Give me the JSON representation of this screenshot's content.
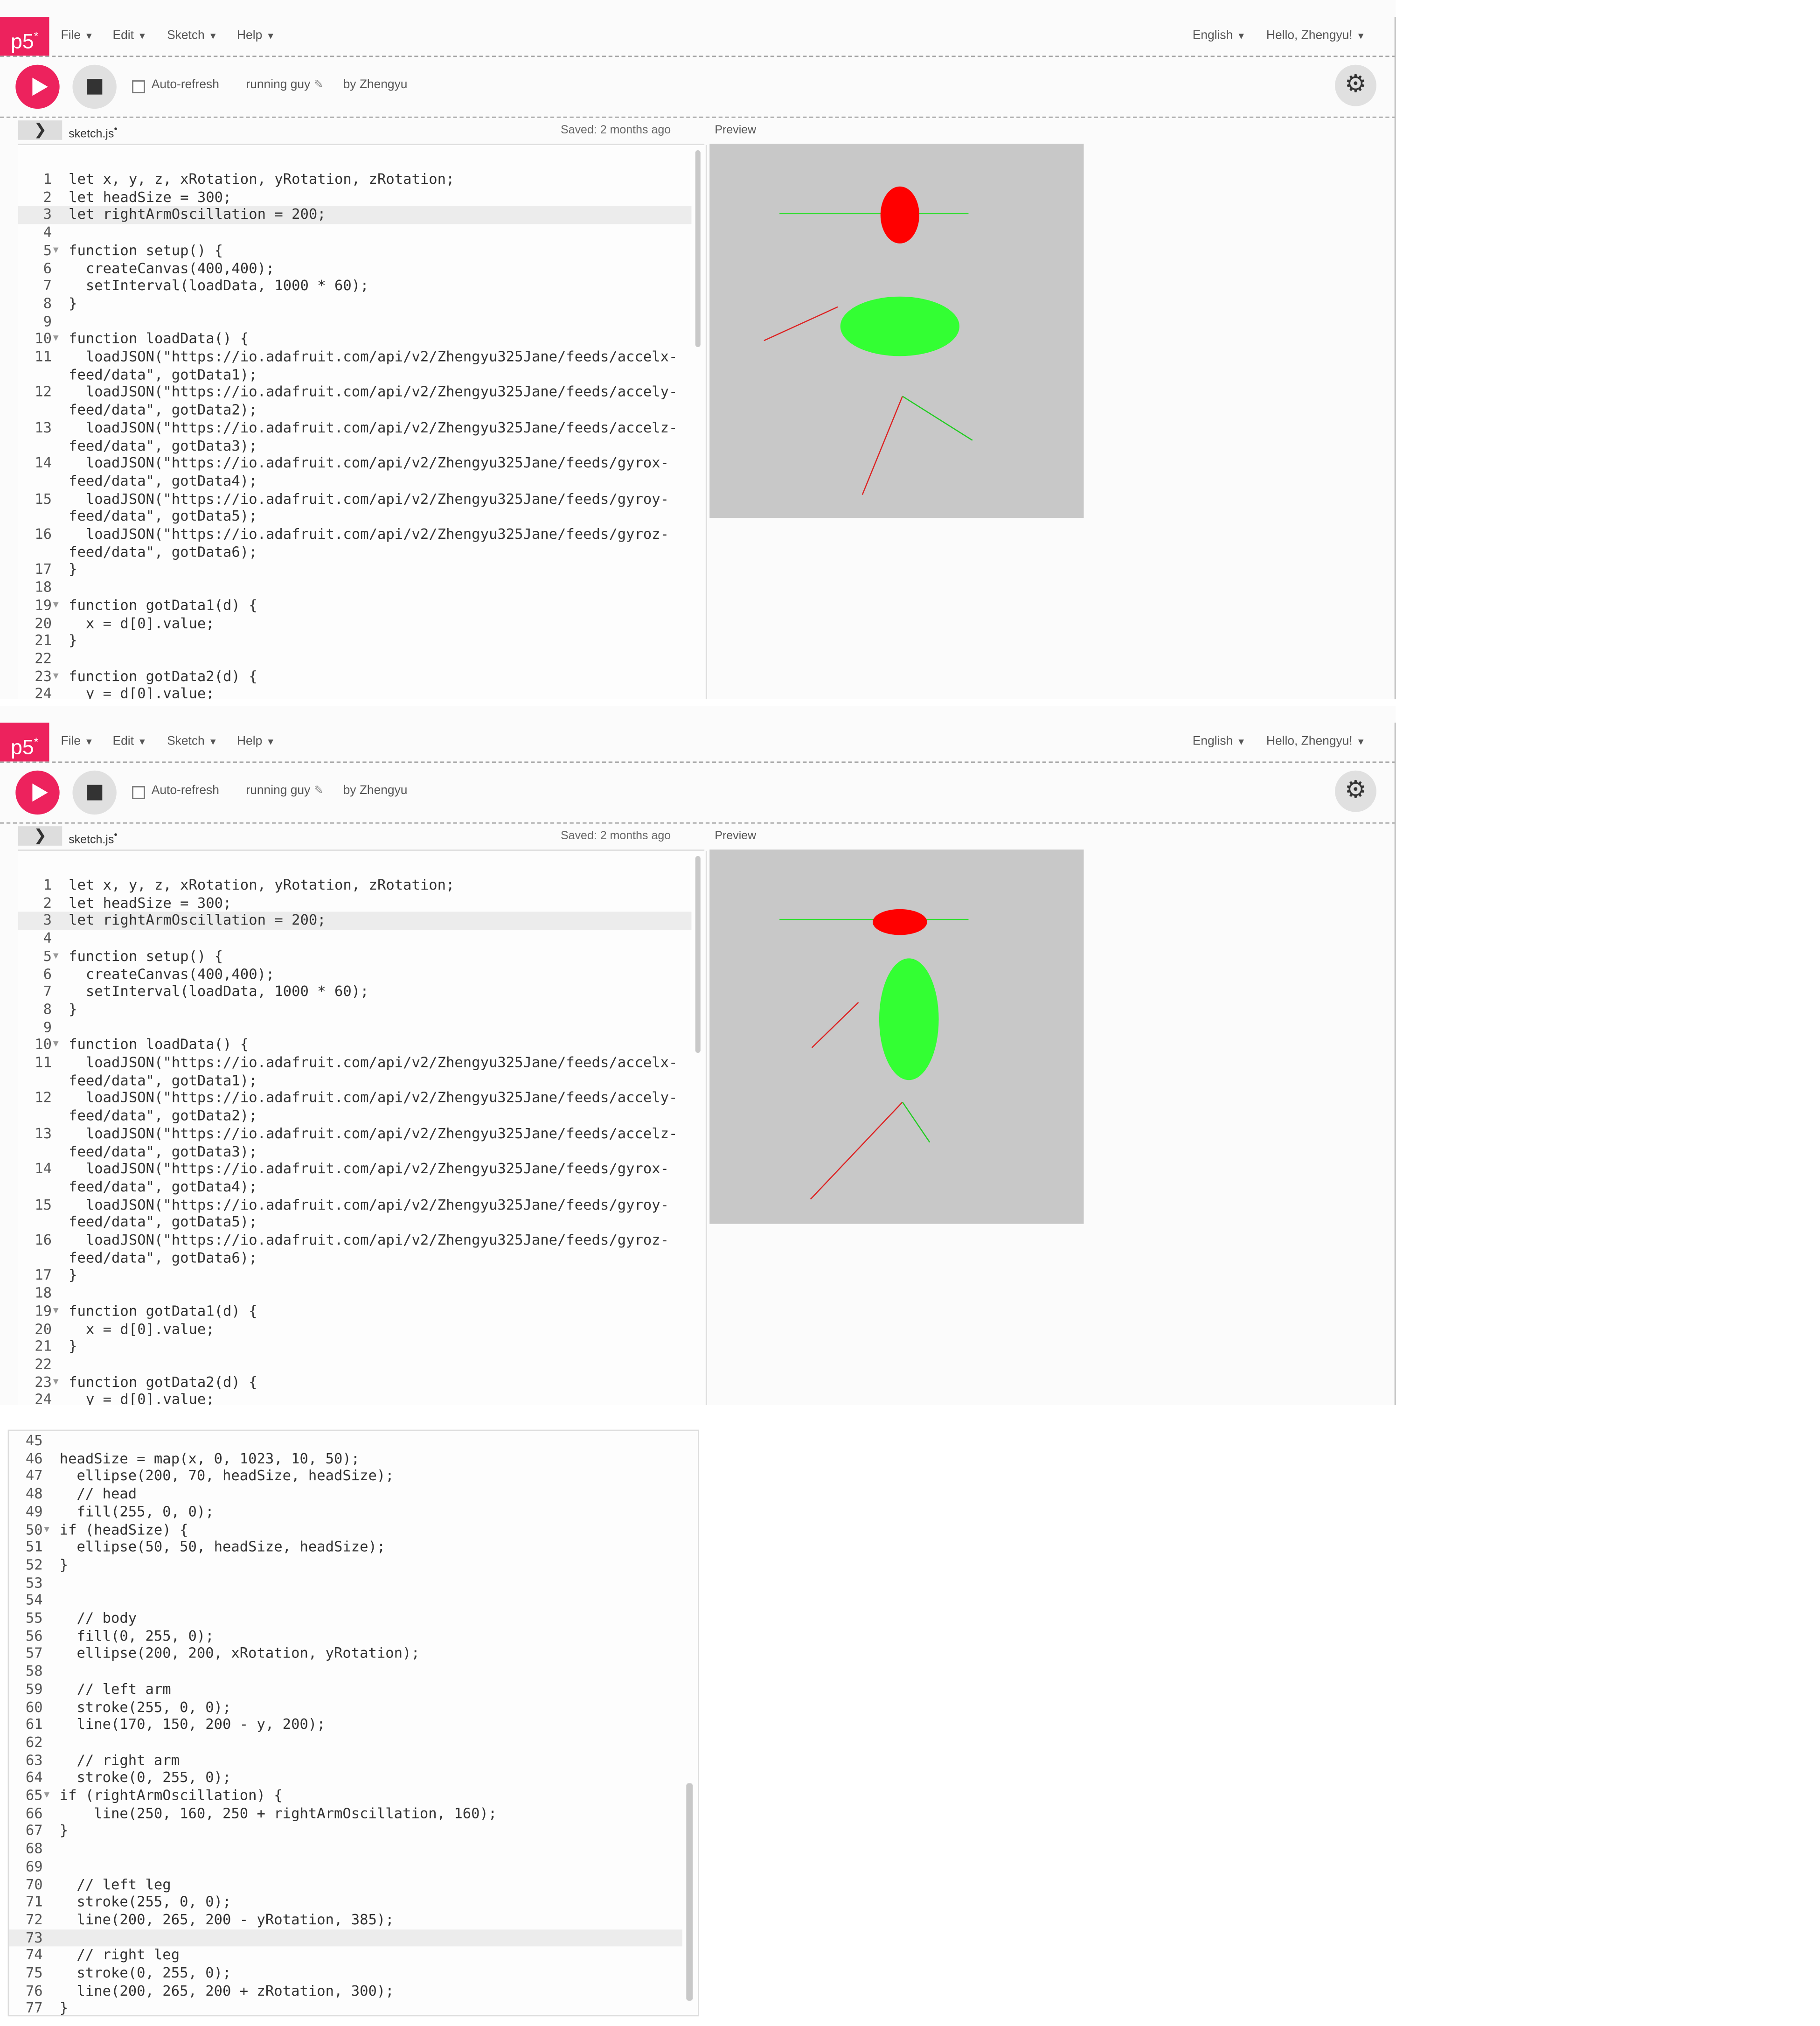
{
  "app": {
    "logo": "p5*",
    "menus": [
      "File",
      "Edit",
      "Sketch",
      "Help"
    ],
    "language": "English",
    "user": "Hello, Zhengyu!"
  },
  "toolbar": {
    "auto_refresh_label": "Auto-refresh",
    "sketch_name": "running guy",
    "author": "by Zhengyu"
  },
  "editor": {
    "file_name": "sketch.js",
    "saved_status": "Saved: 2 months ago",
    "preview_label": "Preview"
  },
  "code_top": [
    {
      "n": "1",
      "t": "let x, y, z, xRotation, yRotation, zRotation;"
    },
    {
      "n": "2",
      "t": "let headSize = 300;"
    },
    {
      "n": "3",
      "t": "let rightArmOscillation = 200;"
    },
    {
      "n": "4",
      "t": ""
    },
    {
      "n": "5",
      "t": "function setup() {"
    },
    {
      "n": "6",
      "t": "  createCanvas(400,400);"
    },
    {
      "n": "7",
      "t": "  setInterval(loadData, 1000 * 60);"
    },
    {
      "n": "8",
      "t": "}"
    },
    {
      "n": "9",
      "t": ""
    },
    {
      "n": "10",
      "t": "function loadData() {"
    },
    {
      "n": "11",
      "t": "  loadJSON(\"https://io.adafruit.com/api/v2/Zhengyu325Jane/feeds/accelx-"
    },
    {
      "n": "",
      "t": "feed/data\", gotData1);"
    },
    {
      "n": "12",
      "t": "  loadJSON(\"https://io.adafruit.com/api/v2/Zhengyu325Jane/feeds/accely-"
    },
    {
      "n": "",
      "t": "feed/data\", gotData2);"
    },
    {
      "n": "13",
      "t": "  loadJSON(\"https://io.adafruit.com/api/v2/Zhengyu325Jane/feeds/accelz-"
    },
    {
      "n": "",
      "t": "feed/data\", gotData3);"
    },
    {
      "n": "14",
      "t": "  loadJSON(\"https://io.adafruit.com/api/v2/Zhengyu325Jane/feeds/gyrox-"
    },
    {
      "n": "",
      "t": "feed/data\", gotData4);"
    },
    {
      "n": "15",
      "t": "  loadJSON(\"https://io.adafruit.com/api/v2/Zhengyu325Jane/feeds/gyroy-"
    },
    {
      "n": "",
      "t": "feed/data\", gotData5);"
    },
    {
      "n": "16",
      "t": "  loadJSON(\"https://io.adafruit.com/api/v2/Zhengyu325Jane/feeds/gyroz-"
    },
    {
      "n": "",
      "t": "feed/data\", gotData6);"
    },
    {
      "n": "17",
      "t": "}"
    },
    {
      "n": "18",
      "t": ""
    },
    {
      "n": "19",
      "t": "function gotData1(d) {"
    },
    {
      "n": "20",
      "t": "  x = d[0].value;"
    },
    {
      "n": "21",
      "t": "}"
    },
    {
      "n": "22",
      "t": ""
    },
    {
      "n": "23",
      "t": "function gotData2(d) {"
    },
    {
      "n": "24",
      "t": "  y = d[0].value;"
    }
  ],
  "code_bottom": [
    {
      "n": "45",
      "t": ""
    },
    {
      "n": "46",
      "t": "headSize = map(x, 0, 1023, 10, 50);"
    },
    {
      "n": "47",
      "t": "  ellipse(200, 70, headSize, headSize);"
    },
    {
      "n": "48",
      "t": "  // head"
    },
    {
      "n": "49",
      "t": "  fill(255, 0, 0);"
    },
    {
      "n": "50",
      "t": "if (headSize) {"
    },
    {
      "n": "51",
      "t": "  ellipse(50, 50, headSize, headSize);"
    },
    {
      "n": "52",
      "t": "}"
    },
    {
      "n": "53",
      "t": ""
    },
    {
      "n": "54",
      "t": ""
    },
    {
      "n": "55",
      "t": "  // body"
    },
    {
      "n": "56",
      "t": "  fill(0, 255, 0);"
    },
    {
      "n": "57",
      "t": "  ellipse(200, 200, xRotation, yRotation);"
    },
    {
      "n": "58",
      "t": ""
    },
    {
      "n": "59",
      "t": "  // left arm"
    },
    {
      "n": "60",
      "t": "  stroke(255, 0, 0);"
    },
    {
      "n": "61",
      "t": "  line(170, 150, 200 - y, 200);"
    },
    {
      "n": "62",
      "t": ""
    },
    {
      "n": "63",
      "t": "  // right arm"
    },
    {
      "n": "64",
      "t": "  stroke(0, 255, 0);"
    },
    {
      "n": "65",
      "t": "if (rightArmOscillation) {"
    },
    {
      "n": "66",
      "t": "    line(250, 160, 250 + rightArmOscillation, 160);"
    },
    {
      "n": "67",
      "t": "}"
    },
    {
      "n": "68",
      "t": ""
    },
    {
      "n": "69",
      "t": ""
    },
    {
      "n": "70",
      "t": "  // left leg"
    },
    {
      "n": "71",
      "t": "  stroke(255, 0, 0);"
    },
    {
      "n": "72",
      "t": "  line(200, 265, 200 - yRotation, 385);"
    },
    {
      "n": "73",
      "t": ""
    },
    {
      "n": "74",
      "t": "  // right leg"
    },
    {
      "n": "75",
      "t": "  stroke(0, 255, 0);"
    },
    {
      "n": "76",
      "t": "  line(200, 265, 200 + zRotation, 300);"
    },
    {
      "n": "77",
      "t": "}"
    }
  ],
  "colors": {
    "brand": "#ed225d",
    "canvas_bg": "#c8c8c8",
    "head": "#ff0000",
    "body": "#33ff33",
    "red_stroke": "#ff0000",
    "green_stroke": "#00ff00"
  }
}
